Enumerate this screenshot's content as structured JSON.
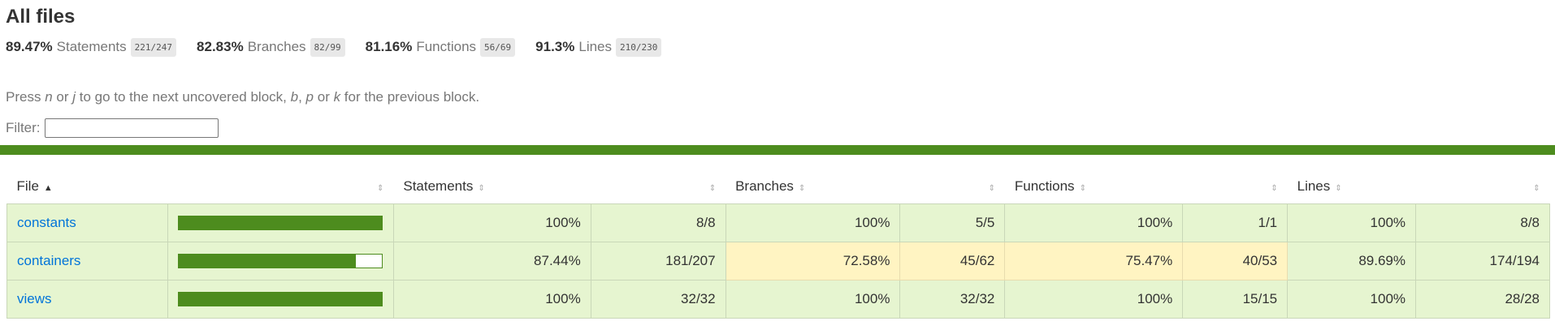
{
  "page": {
    "title": "All files",
    "summary": [
      {
        "pct": "89.47%",
        "label": "Statements",
        "fraction": "221/247"
      },
      {
        "pct": "82.83%",
        "label": "Branches",
        "fraction": "82/99"
      },
      {
        "pct": "81.16%",
        "label": "Functions",
        "fraction": "56/69"
      },
      {
        "pct": "91.3%",
        "label": "Lines",
        "fraction": "210/230"
      }
    ],
    "hint": {
      "part1": "Press ",
      "key1": "n",
      "part2": " or ",
      "key2": "j",
      "part3": " to go to the next uncovered block, ",
      "key3": "b",
      "part4": ", ",
      "key4": "p",
      "part5": " or ",
      "key5": "k",
      "part6": " for the previous block."
    },
    "filter": {
      "label": "Filter:",
      "value": ""
    },
    "status_color": "#4d8c1e"
  },
  "table": {
    "headers": {
      "file": "File",
      "statements": "Statements",
      "branches": "Branches",
      "functions": "Functions",
      "lines": "Lines"
    },
    "sort_up_glyph": "▲",
    "sort_glyph": "⇕",
    "rows": [
      {
        "file": "constants",
        "coverage": 1.0,
        "stmt_pct": "100%",
        "stmt_frac": "8/8",
        "br_pct": "100%",
        "br_frac": "5/5",
        "fn_pct": "100%",
        "fn_frac": "1/1",
        "ln_pct": "100%",
        "ln_frac": "8/8"
      },
      {
        "file": "containers",
        "coverage": 0.8744,
        "stmt_pct": "87.44%",
        "stmt_frac": "181/207",
        "br_pct": "72.58%",
        "br_frac": "45/62",
        "fn_pct": "75.47%",
        "fn_frac": "40/53",
        "ln_pct": "89.69%",
        "ln_frac": "174/194"
      },
      {
        "file": "views",
        "coverage": 1.0,
        "stmt_pct": "100%",
        "stmt_frac": "32/32",
        "br_pct": "100%",
        "br_frac": "32/32",
        "fn_pct": "100%",
        "fn_frac": "15/15",
        "ln_pct": "100%",
        "ln_frac": "28/28"
      }
    ]
  }
}
